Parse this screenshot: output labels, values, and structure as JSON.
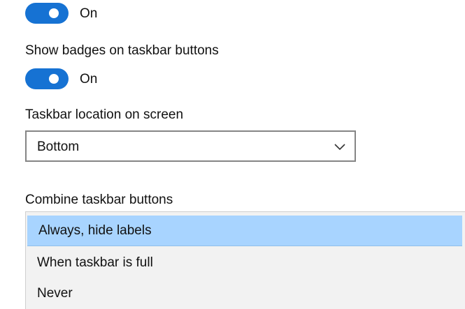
{
  "toggle_top": {
    "state_label": "On",
    "is_on": true
  },
  "show_badges": {
    "label": "Show badges on taskbar buttons",
    "state_label": "On",
    "is_on": true
  },
  "taskbar_location": {
    "label": "Taskbar location on screen",
    "selected": "Bottom"
  },
  "combine_buttons": {
    "label": "Combine taskbar buttons",
    "options": [
      {
        "label": "Always, hide labels",
        "selected": true
      },
      {
        "label": "When taskbar is full",
        "selected": false
      },
      {
        "label": "Never",
        "selected": false
      }
    ]
  },
  "colors": {
    "accent": "#1672d3",
    "highlight": "#a8d4ff",
    "dropdown_bg": "#f2f2f2"
  }
}
